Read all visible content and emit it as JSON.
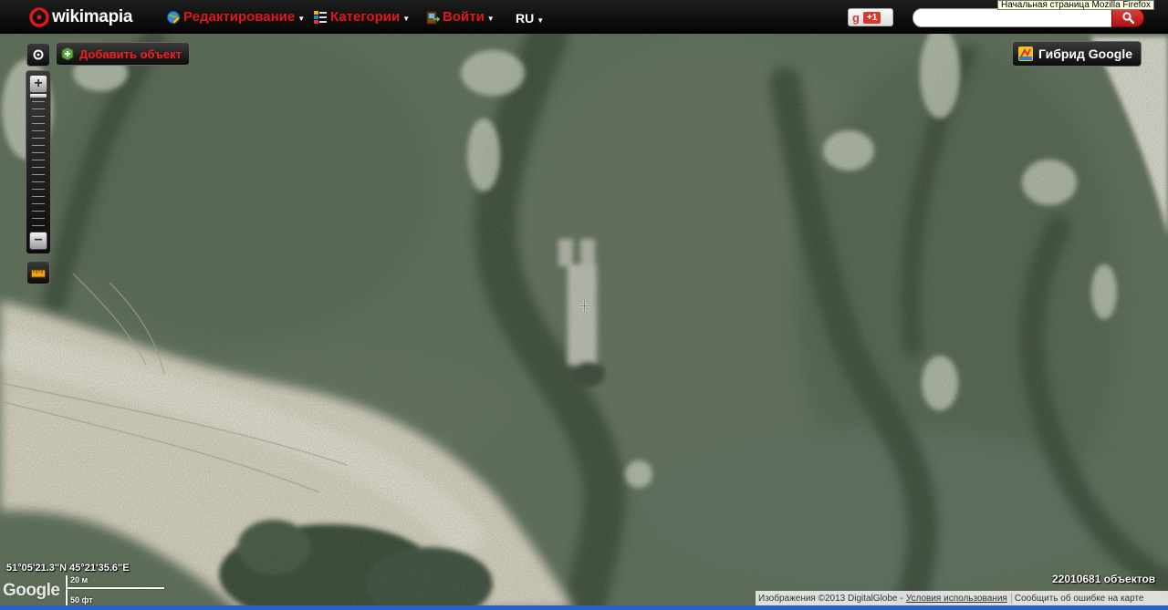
{
  "app": {
    "logo_text": "wikimapia"
  },
  "menu": {
    "edit": "Редактирование",
    "categories": "Категории",
    "login": "Войти",
    "language": "RU"
  },
  "gplus": {
    "g": "g",
    "count": "+1"
  },
  "search": {
    "placeholder": "",
    "value": ""
  },
  "tooltip": "Начальная страница Mozilla Firefox",
  "controls": {
    "add_object": "Добавить объект",
    "map_type": "Гибрид Google"
  },
  "status": {
    "coordinates": "51°05'21.3\"N 45°21'35.6\"E",
    "scale_top": "20 м",
    "scale_bottom": "50 фт",
    "object_count": "22010681 объектов"
  },
  "footer": {
    "copyright": "Изображения ©2013 DigitalGlobe",
    "separator": "-",
    "terms": "Условия использования",
    "report": "Сообщить об ошибке на карте"
  },
  "google_logo": "Google",
  "colors": {
    "accent_red": "#e01818",
    "topbar": "#0a0a0a",
    "satellite_base": "#4d5e4a"
  },
  "icons": {
    "logo": "wikimapia-logo-icon",
    "edit": "globe-edit-icon",
    "categories": "categories-list-icon",
    "login": "login-door-icon",
    "search": "search-icon",
    "settings": "settings-icon",
    "add": "add-object-icon",
    "ruler": "ruler-icon",
    "map_type": "map-type-icon",
    "crosshair": "crosshair-icon"
  }
}
